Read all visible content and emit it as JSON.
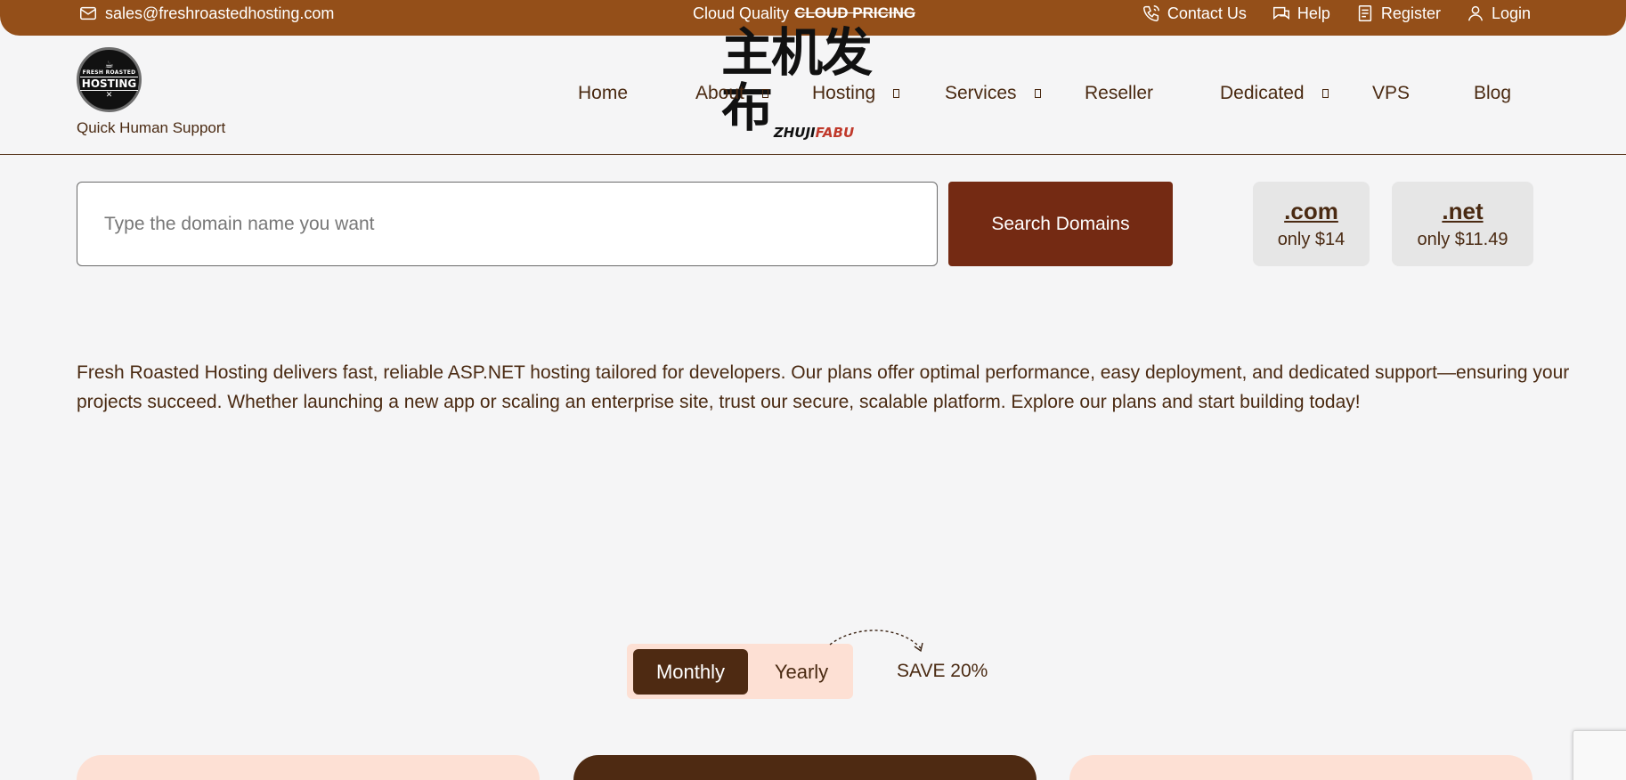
{
  "topbar": {
    "email": "sales@freshroastedhosting.com",
    "promo_prefix": "Cloud Quality",
    "promo_strike": "CLOUD PRICING",
    "links": [
      {
        "label": "Contact Us",
        "icon": "phone-icon"
      },
      {
        "label": "Help",
        "icon": "chat-icon"
      },
      {
        "label": "Register",
        "icon": "register-icon"
      },
      {
        "label": "Login",
        "icon": "user-icon"
      }
    ]
  },
  "header": {
    "logo": {
      "line1": "FRESH ROASTED",
      "line2": "HOSTING"
    },
    "tagline": "Quick Human Support",
    "watermark": {
      "cn": "主机发布",
      "en_a": "ZHUJI",
      "en_b": "FABU"
    },
    "nav": [
      {
        "label": "Home",
        "dropdown": false
      },
      {
        "label": "About",
        "dropdown": true
      },
      {
        "label": "Hosting",
        "dropdown": true
      },
      {
        "label": "Services",
        "dropdown": true
      },
      {
        "label": "Reseller",
        "dropdown": false
      },
      {
        "label": "Dedicated",
        "dropdown": true
      },
      {
        "label": "VPS",
        "dropdown": false
      },
      {
        "label": "Blog",
        "dropdown": false
      }
    ]
  },
  "search": {
    "placeholder": "Type the domain name you want",
    "button_label": "Search Domains",
    "tlds": [
      {
        "name": ".com",
        "price": "only $14"
      },
      {
        "name": ".net",
        "price": "only $11.49"
      }
    ]
  },
  "description": "Fresh Roasted Hosting delivers fast, reliable ASP.NET hosting tailored for developers. Our plans offer optimal performance, easy deployment, and dedicated support—ensuring your projects succeed. Whether launching a new app or scaling an enterprise site, trust our secure, scalable platform. Explore our plans and start building today!",
  "billing": {
    "monthly_label": "Monthly",
    "yearly_label": "Yearly",
    "save_label": "SAVE 20%",
    "selected": "Monthly"
  },
  "colors": {
    "topbar": "#944f19",
    "accent": "#742a13",
    "text": "#4a2a12",
    "card_light": "#fde0d4",
    "card_dark": "#4e2a12"
  }
}
